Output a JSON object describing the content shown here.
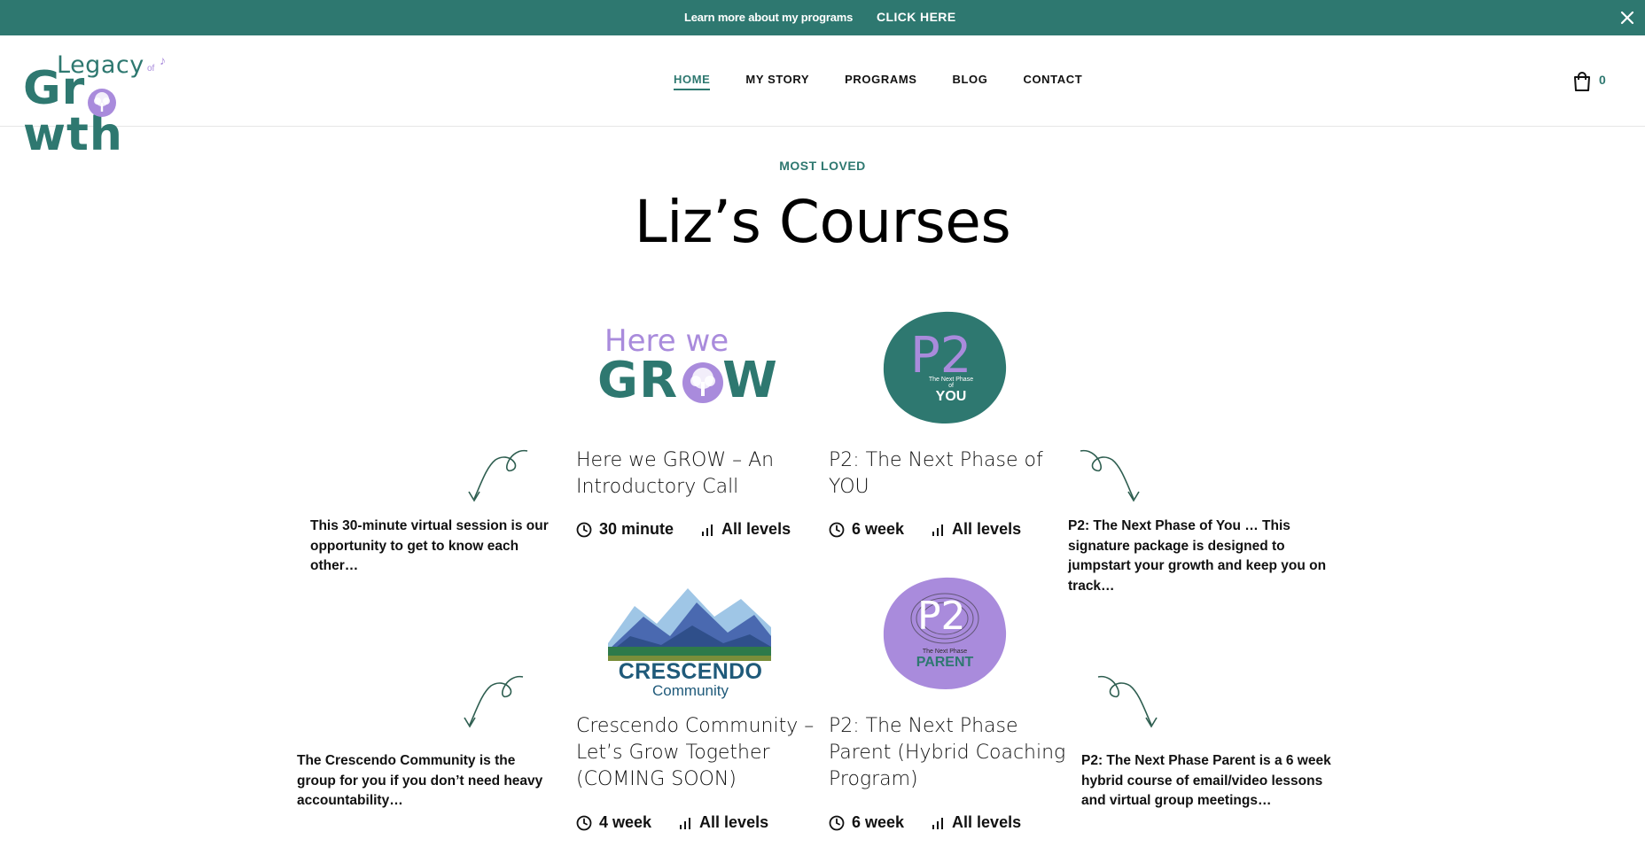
{
  "announcement": {
    "message": "Learn more about my programs",
    "cta": "CLICK HERE"
  },
  "brand": {
    "line1": "Legacy",
    "of": "of",
    "line2_a": "Gr",
    "line2_b": "wth",
    "accent_color": "#2e7870",
    "secondary_color": "#a98bdc"
  },
  "nav": {
    "items": [
      {
        "label": "HOME",
        "active": true
      },
      {
        "label": "MY STORY",
        "active": false
      },
      {
        "label": "PROGRAMS",
        "active": false
      },
      {
        "label": "BLOG",
        "active": false
      },
      {
        "label": "CONTACT",
        "active": false
      }
    ]
  },
  "cart": {
    "icon": "shopping-bag-icon",
    "count": "0"
  },
  "section": {
    "eyebrow": "MOST LOVED",
    "title": "Liz’s Courses"
  },
  "courses": [
    {
      "logo_top": "Here we",
      "logo_bottom_a": "GR",
      "logo_bottom_b": "W",
      "title": "Here we GROW – An Introductory Call",
      "duration": "30 minute",
      "level": "All levels",
      "description": "This 30-minute virtual session is our opportunity to get to know each other…"
    },
    {
      "logo_big": "P2",
      "logo_small1": "The Next Phase",
      "logo_small2": "of",
      "logo_word": "YOU",
      "title": "P2: The Next Phase of YOU",
      "duration": "6 week",
      "level": "All levels",
      "description": "P2: The Next Phase of You … This signature package is designed to jumpstart your growth and keep you on track…"
    },
    {
      "logo_word": "CRESCENDO",
      "logo_sub": "Community",
      "title": "Crescendo Community – Let’s Grow Together (COMING SOON)",
      "duration": "4 week",
      "level": "All levels",
      "description": "The Crescendo Community is the group for you if you don’t need heavy accountability…"
    },
    {
      "logo_big": "P2",
      "logo_small1": "The Next Phase",
      "logo_word": "PARENT",
      "title": "P2: The Next Phase Parent (Hybrid Coaching Program)",
      "duration": "6 week",
      "level": "All levels",
      "description": "P2: The Next Phase Parent is a 6 week hybrid course of email/video lessons and virtual group meetings…"
    }
  ]
}
